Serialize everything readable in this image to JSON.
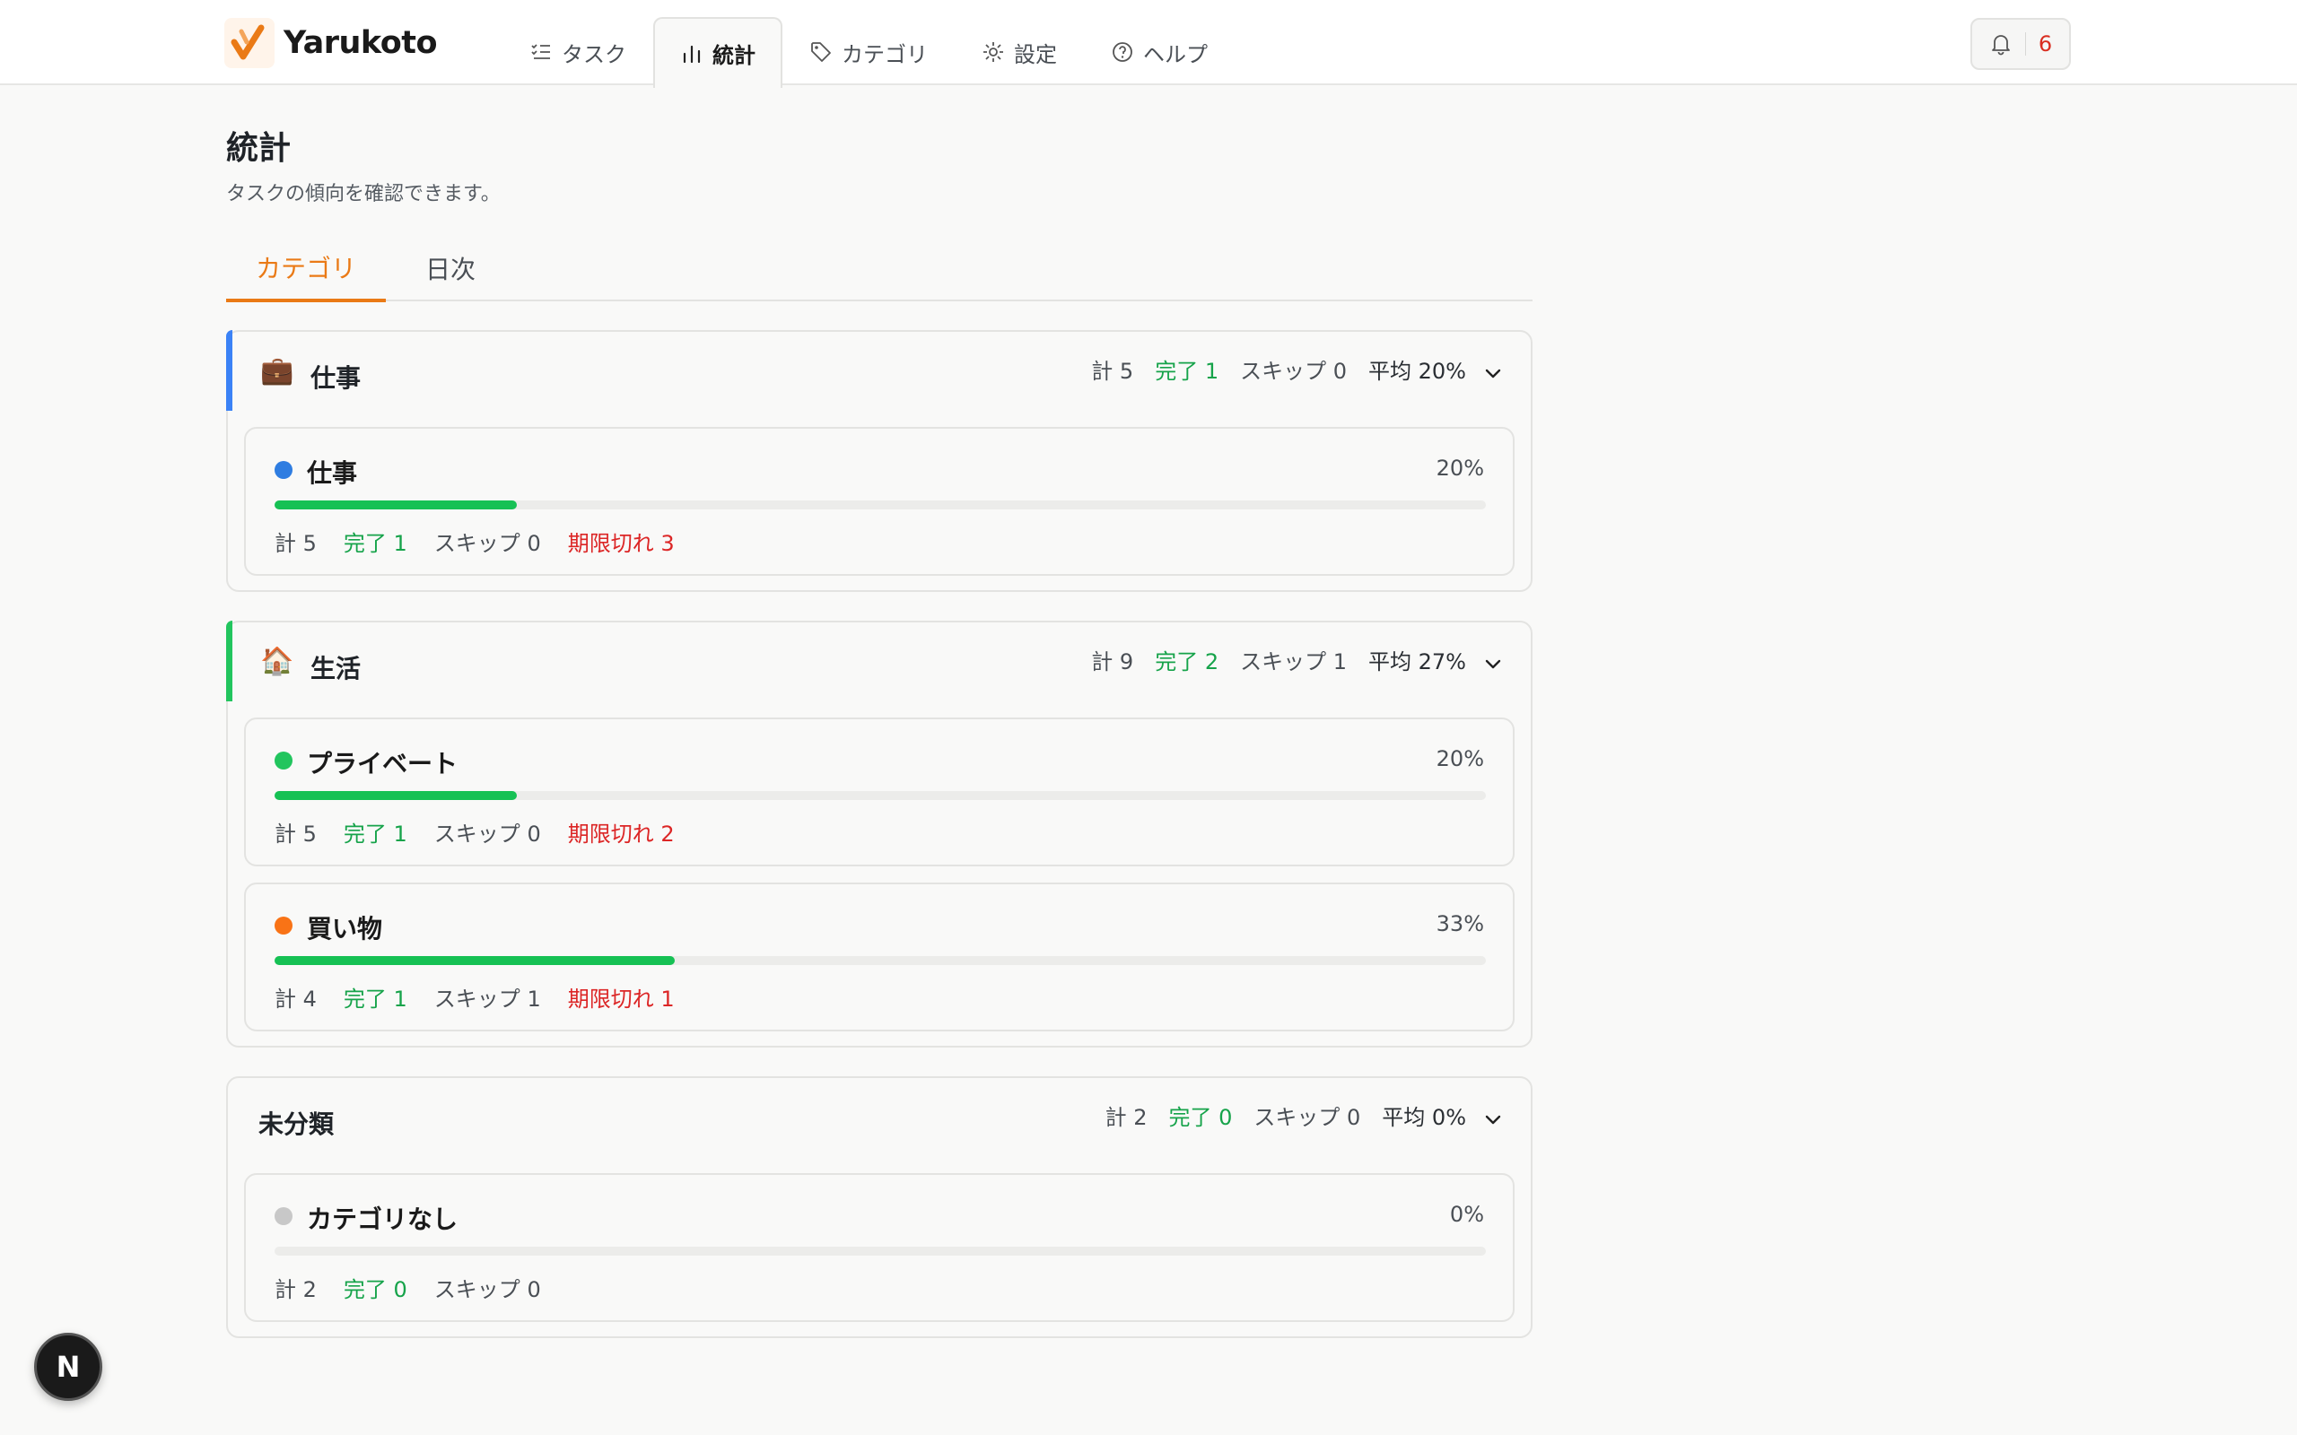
{
  "app": {
    "name": "Yarukoto"
  },
  "nav": {
    "tasks": "タスク",
    "stats": "統計",
    "categories": "カテゴリ",
    "settings": "設定",
    "help": "ヘルプ"
  },
  "notifications": {
    "count": "6"
  },
  "page": {
    "title": "統計",
    "subtitle": "タスクの傾向を確認できます。"
  },
  "tabs": {
    "category": "カテゴリ",
    "daily": "日次",
    "active": "category"
  },
  "groups": [
    {
      "emoji": "💼",
      "name": "仕事",
      "accent": "#3b82f6",
      "total": "計 5",
      "done": "完了 1",
      "skip": "スキップ 0",
      "avg": "平均 20%",
      "items": [
        {
          "name": "仕事",
          "color": "#2f7de1",
          "pct": "20%",
          "progress": 0.2,
          "total": "計 5",
          "done": "完了 1",
          "skip": "スキップ 0",
          "overdue": "期限切れ 3"
        }
      ]
    },
    {
      "emoji": "🏠",
      "name": "生活",
      "accent": "#22c55e",
      "total": "計 9",
      "done": "完了 2",
      "skip": "スキップ 1",
      "avg": "平均 27%",
      "items": [
        {
          "name": "プライベート",
          "color": "#22c55e",
          "pct": "20%",
          "progress": 0.2,
          "total": "計 5",
          "done": "完了 1",
          "skip": "スキップ 0",
          "overdue": "期限切れ 2"
        },
        {
          "name": "買い物",
          "color": "#f97316",
          "pct": "33%",
          "progress": 0.33,
          "total": "計 4",
          "done": "完了 1",
          "skip": "スキップ 1",
          "overdue": "期限切れ 1"
        }
      ]
    },
    {
      "emoji": "",
      "name": "未分類",
      "accent": "",
      "total": "計 2",
      "done": "完了 0",
      "skip": "スキップ 0",
      "avg": "平均 0%",
      "items": [
        {
          "name": "カテゴリなし",
          "color": "#c8c8c8",
          "pct": "0%",
          "progress": 0,
          "total": "計 2",
          "done": "完了 0",
          "skip": "スキップ 0",
          "overdue": ""
        }
      ]
    }
  ],
  "colors": {
    "accent": "#ea7a16",
    "done": "#16a34a",
    "overdue": "#dc2626",
    "bar": "#16c154"
  },
  "dev_badge": "N"
}
